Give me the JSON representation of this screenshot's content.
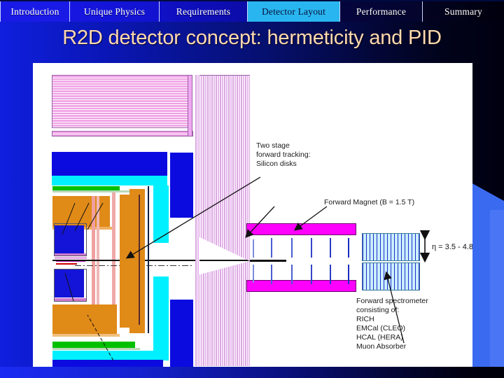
{
  "navbar": {
    "tabs": [
      {
        "label": "Introduction",
        "active": false
      },
      {
        "label": "Unique Physics",
        "active": false
      },
      {
        "label": "Requirements",
        "active": false
      },
      {
        "label": "Detector Layout",
        "active": true
      },
      {
        "label": "Performance",
        "active": false
      },
      {
        "label": "Summary",
        "active": false
      }
    ]
  },
  "slide": {
    "title": "R2D detector concept: hermeticity and PID"
  },
  "figure": {
    "annotations": {
      "forward_tracking": "Two stage\nforward tracking:\nSilicon disks",
      "forward_magnet": "Forward Magnet (B = 1.5 T)",
      "eta_range": "η = 3.5 - 4.8",
      "forward_spectrometer": "Forward spectrometer\nconsisting of:\nRICH\nEMCal (CLEO)\nHCAL (HERA)\nMuon Absorber"
    }
  },
  "colors": {
    "accent_blue": "#1a1ae6",
    "active_tab": "#29b6f0",
    "title_text": "#ffd9ad",
    "magnet_magenta": "#ff00ff",
    "barrel_blue": "#0b0be0",
    "cyan": "#00f0ff",
    "orange": "#e08a18",
    "green": "#00c000",
    "pink_stripe": "#e8b9ee",
    "slide_bg": "#0a16b4"
  }
}
